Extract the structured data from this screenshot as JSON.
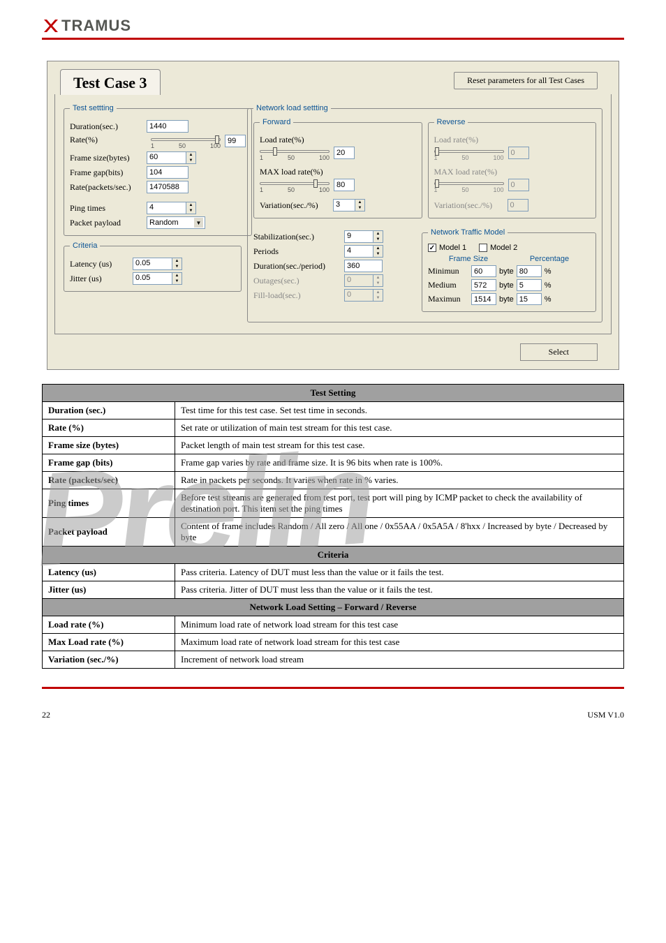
{
  "brand": "TRAMUS",
  "screenshot": {
    "tab_title": "Test Case 3",
    "reset_btn": "Reset parameters for all Test Cases",
    "select_btn": "Select",
    "test_setting": {
      "legend": "Test settting",
      "duration_label": "Duration(sec.)",
      "duration_value": "1440",
      "rate_label": "Rate(%)",
      "rate_value": "99",
      "tick1": "1",
      "tick50": "50",
      "tick100": "100",
      "frame_size_label": "Frame size(bytes)",
      "frame_size_value": "60",
      "frame_gap_label": "Frame gap(bits)",
      "frame_gap_value": "104",
      "rate_pps_label": "Rate(packets/sec.)",
      "rate_pps_value": "1470588",
      "ping_label": "Ping times",
      "ping_value": "4",
      "payload_label": "Packet payload",
      "payload_value": "Random"
    },
    "criteria": {
      "legend": "Criteria",
      "latency_label": "Latency (us)",
      "latency_value": "0.05",
      "jitter_label": "Jitter (us)",
      "jitter_value": "0.05"
    },
    "network_load": {
      "legend": "Network load settting",
      "forward": {
        "legend": "Forward",
        "load_rate_label": "Load rate(%)",
        "load_rate_value": "20",
        "max_load_label": "MAX load rate(%)",
        "max_load_value": "80",
        "variation_label": "Variation(sec./%)",
        "variation_value": "3"
      },
      "reverse": {
        "legend": "Reverse",
        "load_rate_label": "Load rate(%)",
        "load_rate_value": "0",
        "max_load_label": "MAX load rate(%)",
        "max_load_value": "0",
        "variation_label": "Variation(sec./%)",
        "variation_value": "0"
      },
      "stab_label": "Stabilization(sec.)",
      "stab_value": "9",
      "periods_label": "Periods",
      "periods_value": "4",
      "dur_period_label": "Duration(sec./period)",
      "dur_period_value": "360",
      "outages_label": "Outages(sec.)",
      "outages_value": "0",
      "fill_label": "Fill-load(sec.)",
      "fill_value": "0",
      "traffic_model": {
        "legend": "Network Traffic Model",
        "model1": "Model 1",
        "model2": "Model 2",
        "frame_size": "Frame Size",
        "percentage": "Percentage",
        "min_label": "Minimun",
        "min_byte": "60",
        "min_pct": "80",
        "med_label": "Medium",
        "med_byte": "572",
        "med_pct": "5",
        "max_label": "Maximun",
        "max_byte": "1514",
        "max_pct": "15",
        "byte": "byte",
        "pct": "%"
      },
      "ticks": {
        "t1": "1",
        "t50": "50",
        "t100": "100"
      }
    }
  },
  "watermark": "Prelin",
  "table": {
    "sections": {
      "test": "Test Setting",
      "criteria": "Criteria",
      "network": "Network Load Setting – Forward / Reverse"
    },
    "rows": {
      "duration": {
        "l": "Duration (sec.)",
        "d": "Test time for this test case. Set test time in seconds."
      },
      "rate": {
        "l": "Rate (%)",
        "d": "Set rate or utilization of main test stream for this test case."
      },
      "frame_size": {
        "l": "Frame size (bytes)",
        "d": "Packet length of main test stream for this test case."
      },
      "frame_gap": {
        "l": "Frame gap (bits)",
        "d": "Frame gap varies by rate and frame size. It is 96 bits when rate is 100%."
      },
      "rate_pps": {
        "l": "Rate (packets/sec)",
        "d": "Rate in packets per seconds. It varies when rate in % varies."
      },
      "ping": {
        "l": "Ping times",
        "d": "Before test streams are generated from test port, test port will ping by ICMP packet to check the availability of destination port. This item set the ping times"
      },
      "payload": {
        "l": "Packet payload",
        "d": "Content of frame includes Random / All zero / All one / 0x55AA / 0x5A5A / 8'hxx / Increased by byte / Decreased by byte"
      },
      "latency": {
        "l": "Latency (us)",
        "d": "Pass criteria. Latency of DUT must less than the value or it fails the test."
      },
      "jitter": {
        "l": "Jitter (us)",
        "d": "Pass criteria. Jitter of DUT must less than the value or it fails the test."
      },
      "load_rate": {
        "l": "Load rate (%)",
        "d": "Minimum load rate of network load stream for this test case"
      },
      "max_load": {
        "l": "Max Load rate (%)",
        "d": "Maximum load rate of network load stream for this test case"
      },
      "variation": {
        "l": "Variation (sec./%)",
        "d": "Increment of network load stream"
      }
    }
  },
  "footer": {
    "left": "22",
    "right": "USM V1.0"
  }
}
